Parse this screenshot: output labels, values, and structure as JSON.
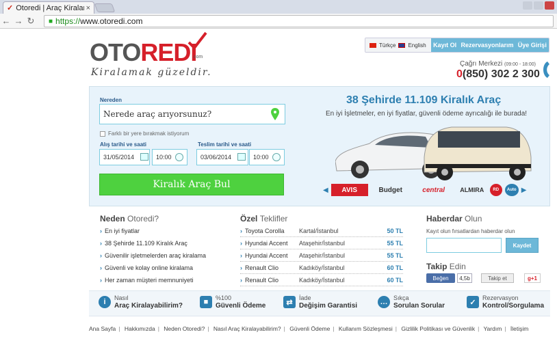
{
  "browser": {
    "tab_title": "Otoredi | Araç Kiralama, A",
    "url_scheme": "https://",
    "url_rest": "www.otoredi.com"
  },
  "header": {
    "logo_oto": "OTO",
    "logo_redi": "REDI",
    "logo_com": ".com",
    "slogan": "Kiralamak güzeldir.",
    "lang_tr": "Türkçe",
    "lang_en": "English",
    "nav": [
      "Kayıt Ol",
      "Rezervasyonlarım",
      "Üye Girişi"
    ],
    "call_label": "Çağrı Merkezi",
    "call_hours": "(09:00 - 18:00)",
    "phone_zero": "0",
    "phone": "(850) 302 2 300"
  },
  "search": {
    "from_label": "Nereden",
    "from_placeholder": "Nerede araç arıyorsunuz?",
    "diff_return": "Farklı bir yere bırakmak istiyorum",
    "pickup_label": "Alış tarihi ve saati",
    "pickup_date": "31/05/2014",
    "pickup_time": "10:00",
    "return_label": "Teslim tarihi ve saati",
    "return_date": "03/06/2014",
    "return_time": "10:00",
    "find_button": "Kiralık Araç Bul"
  },
  "promo": {
    "headline": "38 Şehirde 11.109 Kiralık Araç",
    "sub": "En iyi İşletmeler, en iyi fiyatlar, güvenli ödeme ayrıcalığı ile burada!",
    "brands": [
      "AVIS",
      "Budget",
      "central",
      "ALMIRA",
      "RD",
      "Auto"
    ]
  },
  "why": {
    "title_bold": "Neden",
    "title_light": "Otoredi?",
    "items": [
      "En iyi fiyatlar",
      "38 Şehirde 11.109 Kiralık Araç",
      "Güvenilir işletmelerden araç kiralama",
      "Güvenli ve kolay online kiralama",
      "Her zaman müşteri memnuniyeti"
    ]
  },
  "offers": {
    "title_bold": "Özel",
    "title_light": "Teklifler",
    "rows": [
      {
        "car": "Toyota Corolla",
        "loc": "Kartal/İstanbul",
        "price": "50 TL"
      },
      {
        "car": "Hyundai Accent",
        "loc": "Ataşehir/İstanbul",
        "price": "55 TL"
      },
      {
        "car": "Hyundai Accent",
        "loc": "Ataşehir/İstanbul",
        "price": "55 TL"
      },
      {
        "car": "Renault Clio",
        "loc": "Kadıköy/İstanbul",
        "price": "60 TL"
      },
      {
        "car": "Renault Clio",
        "loc": "Kadıköy/İstanbul",
        "price": "60 TL"
      }
    ]
  },
  "news": {
    "title_bold": "Haberdar",
    "title_light": "Olun",
    "desc": "Kayıt olun fırsatlardan haberdar olun",
    "button": "Kaydet",
    "follow_bold": "Takip",
    "follow_light": "Edin",
    "fb_like": "Beğen",
    "fb_count": "4,5b",
    "tw_follow": "Takip et",
    "gplus": "g+1"
  },
  "features": [
    {
      "top": "Nasıl",
      "bottom": "Araç Kiralayabilirim?",
      "icon": "i"
    },
    {
      "top": "%100",
      "bottom": "Güvenli Ödeme",
      "icon": "lock"
    },
    {
      "top": "İade",
      "bottom": "Değişim Garantisi",
      "icon": "arrows"
    },
    {
      "top": "Sıkça",
      "bottom": "Sorulan Sorular",
      "icon": "chat"
    },
    {
      "top": "Rezervasyon",
      "bottom": "Kontrol/Sorgulama",
      "icon": "clipboard"
    }
  ],
  "footer": [
    "Ana Sayfa",
    "Hakkımızda",
    "Neden Otoredi?",
    "Nasıl Araç Kiralayabilirim?",
    "Güvenli Ödeme",
    "Kullanım Sözleşmesi",
    "Gizlilik Politikası ve Güvenlik",
    "Yardım",
    "İletişim"
  ]
}
